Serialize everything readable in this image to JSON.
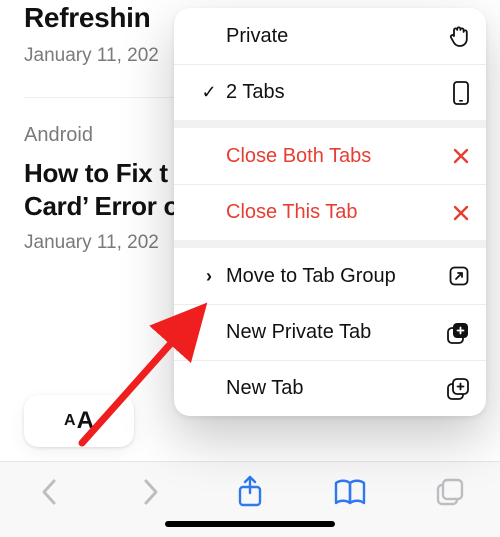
{
  "colors": {
    "accent": "#2f78f2",
    "danger": "#e63e32",
    "text": "#111111",
    "muted": "#7a7a7a"
  },
  "background": {
    "article1": {
      "title_visible": "Refreshin",
      "date_visible": "January 11, 202"
    },
    "article2": {
      "category": "Android",
      "title_line1": "How to Fix t",
      "title_line2": "Card’ Error o",
      "date_visible": "January 11, 202"
    }
  },
  "font_pill": {
    "small": "A",
    "big": "A"
  },
  "menu": {
    "section1": [
      {
        "label": "Private",
        "lead": "",
        "trail_icon": "hand-icon"
      },
      {
        "label": "2 Tabs",
        "lead": "✓",
        "trail_icon": "phone-icon"
      }
    ],
    "section2": [
      {
        "label": "Close Both Tabs",
        "lead": "",
        "trail_icon": "x-icon",
        "danger": true
      },
      {
        "label": "Close This Tab",
        "lead": "",
        "trail_icon": "x-icon",
        "danger": true
      }
    ],
    "section3": [
      {
        "label": "Move to Tab Group",
        "lead": "›",
        "trail_icon": "open-icon"
      },
      {
        "label": "New Private Tab",
        "lead": "",
        "trail_icon": "tabs-plus-filled-icon"
      },
      {
        "label": "New Tab",
        "lead": "",
        "trail_icon": "tabs-plus-icon"
      }
    ]
  },
  "toolbar": {
    "back": "back-icon",
    "forward": "forward-icon",
    "share": "share-icon",
    "bookmarks": "bookmarks-icon",
    "tabs": "tabs-icon"
  }
}
